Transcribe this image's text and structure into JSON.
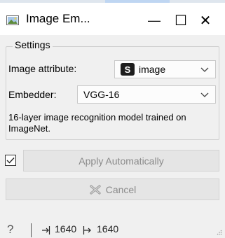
{
  "window": {
    "title": "Image Em...",
    "minimize_glyph": "—",
    "maximize_glyph": "☐",
    "close_glyph": "✕"
  },
  "settings": {
    "group_label": "Settings",
    "image_attribute_label": "Image attribute:",
    "image_attribute_value": "image",
    "image_attribute_badge": "S",
    "embedder_label": "Embedder:",
    "embedder_value": "VGG-16",
    "description": "16-layer image recognition model trained on ImageNet."
  },
  "apply": {
    "checked": true,
    "apply_label": "Apply Automatically",
    "cancel_label": "Cancel"
  },
  "status": {
    "help_glyph": "?",
    "input_count": "1640",
    "output_count": "1640"
  },
  "icons": {
    "app": "image-app-icon",
    "chevron": "chevron-down-icon",
    "check": "checkmark-icon",
    "cancel": "cancel-x-icon",
    "input": "input-arrow-icon",
    "output": "output-arrow-icon"
  }
}
